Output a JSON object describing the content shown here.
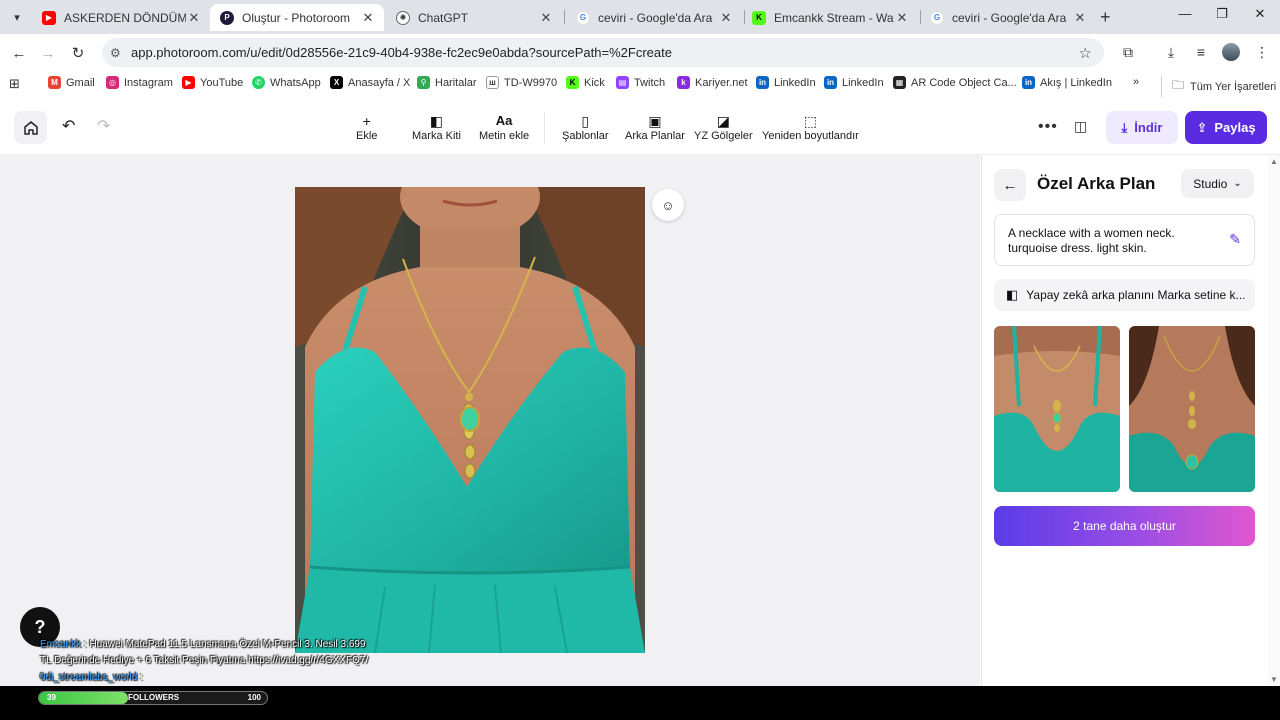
{
  "browser": {
    "tabs": [
      {
        "title": "ASKERDEN DÖNDÜM! - Yo",
        "icon": "youtube-icon",
        "color": "#ff0000",
        "active": false
      },
      {
        "title": "Oluştur - Photoroom",
        "icon": "photoroom-icon",
        "color": "#1c1c3a",
        "active": true
      },
      {
        "title": "ChatGPT",
        "icon": "chatgpt-icon",
        "color": "#444444",
        "active": false
      },
      {
        "title": "ceviri - Google'da Ara",
        "icon": "google-icon",
        "color": "#4285f4",
        "active": false
      },
      {
        "title": "Emcankk Stream - Watch L",
        "icon": "kick-icon",
        "color": "#53fc18",
        "active": false
      },
      {
        "title": "ceviri - Google'da Ara",
        "icon": "google-icon",
        "color": "#4285f4",
        "active": false
      }
    ],
    "url": "app.photoroom.com/u/edit/0d28556e-21c9-40b4-938e-fc2ec9e0abda?sourcePath=%2Fcreate",
    "bookmarks": [
      {
        "label": "Gmail",
        "icon": "gmail-icon",
        "color": "#ea4335"
      },
      {
        "label": "Instagram",
        "icon": "instagram-icon",
        "color": "#d62976"
      },
      {
        "label": "YouTube",
        "icon": "youtube-icon",
        "color": "#ff0000"
      },
      {
        "label": "WhatsApp",
        "icon": "whatsapp-icon",
        "color": "#25d366"
      },
      {
        "label": "Anasayfa / X",
        "icon": "x-icon",
        "color": "#000000"
      },
      {
        "label": "Haritalar",
        "icon": "maps-icon",
        "color": "#34a853"
      },
      {
        "label": "TD-W9970",
        "icon": "router-icon",
        "color": "#333333"
      },
      {
        "label": "Kick",
        "icon": "kick-icon",
        "color": "#53fc18"
      },
      {
        "label": "Twitch",
        "icon": "twitch-icon",
        "color": "#9146ff"
      },
      {
        "label": "Kariyer.net",
        "icon": "kariyer-icon",
        "color": "#8a2be2"
      },
      {
        "label": "LinkedIn",
        "icon": "linkedin-icon",
        "color": "#0a66c2"
      },
      {
        "label": "LinkedIn",
        "icon": "linkedin-icon",
        "color": "#0a66c2"
      },
      {
        "label": "AR Code Object Ca...",
        "icon": "qr-icon",
        "color": "#222222"
      },
      {
        "label": "Akış | LinkedIn",
        "icon": "linkedin-icon",
        "color": "#0a66c2"
      }
    ],
    "all_bookmarks_label": "Tüm Yer İşaretleri"
  },
  "app": {
    "tools": [
      {
        "label": "Ekle",
        "icon": "plus-icon"
      },
      {
        "label": "Marka Kiti",
        "icon": "brand-kit-icon"
      },
      {
        "label": "Metin ekle",
        "icon": "text-icon",
        "glyph": "Aa"
      },
      {
        "label": "Şablonlar",
        "icon": "templates-icon"
      },
      {
        "label": "Arka Planlar",
        "icon": "backgrounds-icon"
      },
      {
        "label": "YZ Gölgeler",
        "icon": "ai-shadows-icon"
      },
      {
        "label": "Yeniden boyutlandır",
        "icon": "resize-icon"
      }
    ],
    "download_label": "İndir",
    "share_label": "Paylaş"
  },
  "panel": {
    "title": "Özel Arka Plan",
    "style_select": "Studio",
    "prompt": "A necklace with a women neck. turquoise dress. light skin.",
    "brand_hint": "Yapay zekâ arka planını Marka setine k...",
    "generate_label": "2 tane daha oluştur"
  },
  "overlay": {
    "chat_nick": "Emcankk",
    "chat_line1": " : Huawei MatePad 11.5 Lansmana Özel M-Pencil 3. Nesil 3.699",
    "chat_line2": "TL Değerinde Hediye + 6 Taksit Peşin Fiyatına https://ivad.gg/r/4GXXFQ7/",
    "chat_line3_nick": "0di_streamlabs_world",
    "chat_line3": " : ",
    "followers_label": "FOLLOWERS",
    "followers_current": "39",
    "followers_goal": "100",
    "followers_progress": 0.39
  },
  "colors": {
    "accent": "#5a2be0",
    "dress": "#22c1b0",
    "skin": "#c98d6a"
  }
}
